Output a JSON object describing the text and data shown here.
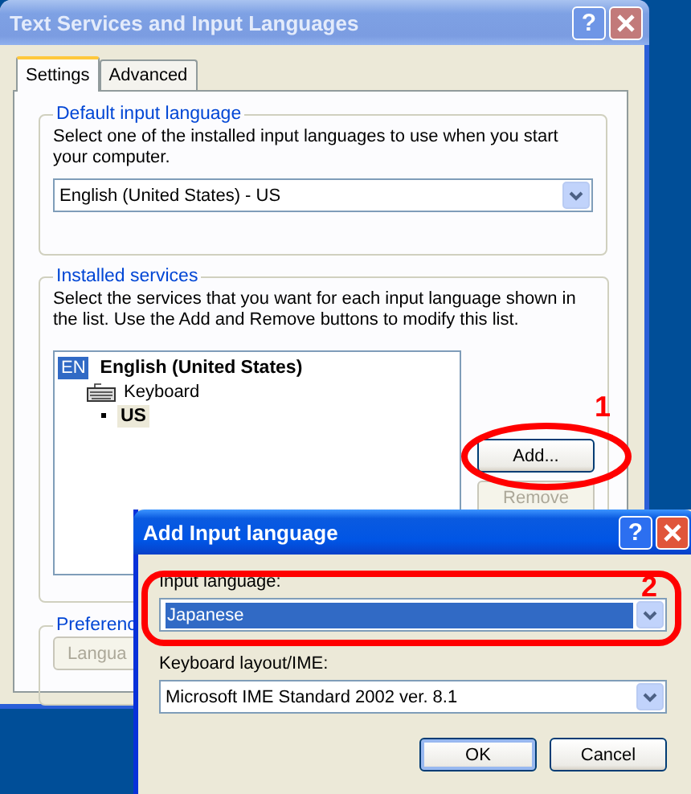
{
  "main_window": {
    "title": "Text Services and Input Languages",
    "help_glyph": "?",
    "tabs": [
      {
        "label": "Settings",
        "selected": true
      },
      {
        "label": "Advanced",
        "selected": false
      }
    ],
    "default_input_language": {
      "heading": "Default input language",
      "description": "Select one of the installed input languages to use when you start your computer.",
      "value": "English (United States) - US"
    },
    "installed_services": {
      "heading": "Installed services",
      "description": "Select the services that you want for each input language shown in the list. Use the Add and Remove buttons to modify this list.",
      "tree": [
        {
          "badge": "EN",
          "label": "English (United States)",
          "selected": false,
          "children": [
            {
              "label": "Keyboard",
              "selected": false,
              "children": [
                {
                  "label": "US",
                  "selected": true
                }
              ]
            }
          ]
        }
      ],
      "buttons": [
        {
          "label": "Add...",
          "disabled": false
        },
        {
          "label": "Remove",
          "disabled": true
        }
      ]
    },
    "preferences": {
      "heading": "Preferenc",
      "button": {
        "label": "Langua",
        "disabled": true
      }
    }
  },
  "dialog": {
    "title": "Add Input language",
    "help_glyph": "?",
    "input_language": {
      "label": "Input language:",
      "value": "Japanese"
    },
    "keyboard_layout": {
      "label": "Keyboard layout/IME:",
      "value": "Microsoft IME Standard 2002 ver. 8.1"
    },
    "buttons": [
      {
        "label": "OK",
        "default": true
      },
      {
        "label": "Cancel",
        "default": false
      }
    ]
  },
  "annotations": [
    {
      "label": "1"
    },
    {
      "label": "2"
    }
  ]
}
